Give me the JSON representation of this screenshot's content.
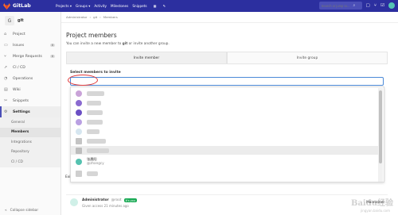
{
  "navbar": {
    "brand": "GitLab",
    "links": [
      "Projects ▾",
      "Groups ▾",
      "Activity",
      "Milestones",
      "Snippets"
    ],
    "search_placeholder": "Search or jump to...",
    "bg_color": "#2c2f9f"
  },
  "sidebar": {
    "project_initial": "G",
    "project_name": "git",
    "items": [
      {
        "label": "Project",
        "icon": "home-icon"
      },
      {
        "label": "Issues",
        "icon": "issues-icon",
        "count": "0"
      },
      {
        "label": "Merge Requests",
        "icon": "merge-request-icon",
        "count": "0"
      },
      {
        "label": "CI / CD",
        "icon": "rocket-icon"
      },
      {
        "label": "Operations",
        "icon": "operations-icon"
      },
      {
        "label": "Wiki",
        "icon": "book-icon"
      },
      {
        "label": "Snippets",
        "icon": "snippet-icon"
      },
      {
        "label": "Settings",
        "icon": "gear-icon"
      }
    ],
    "settings_subitems": [
      "General",
      "Members",
      "Integrations",
      "Repository",
      "CI / CD"
    ],
    "collapse_label": "Collapse sidebar"
  },
  "breadcrumb": [
    "Administrator",
    "git",
    "Members"
  ],
  "main": {
    "title": "Project members",
    "subtitle_prefix": "You can invite a new member to",
    "subtitle_project": "git",
    "subtitle_suffix": "or invite another group.",
    "tabs": [
      "Invite member",
      "Invite group"
    ],
    "select_label": "Select members to invite",
    "existing_prefix": "Exi"
  },
  "dropdown": {
    "visible_name": "张晨阳",
    "visible_handle": "@zhangcy"
  },
  "member": {
    "name": "Administrator",
    "handle": "@root",
    "badge": "It's you",
    "given": "Given access 21 minutes ago",
    "role": "Maintainer"
  },
  "watermark": {
    "text": "Baidu经验",
    "url": "jingyan.baidu.com"
  }
}
